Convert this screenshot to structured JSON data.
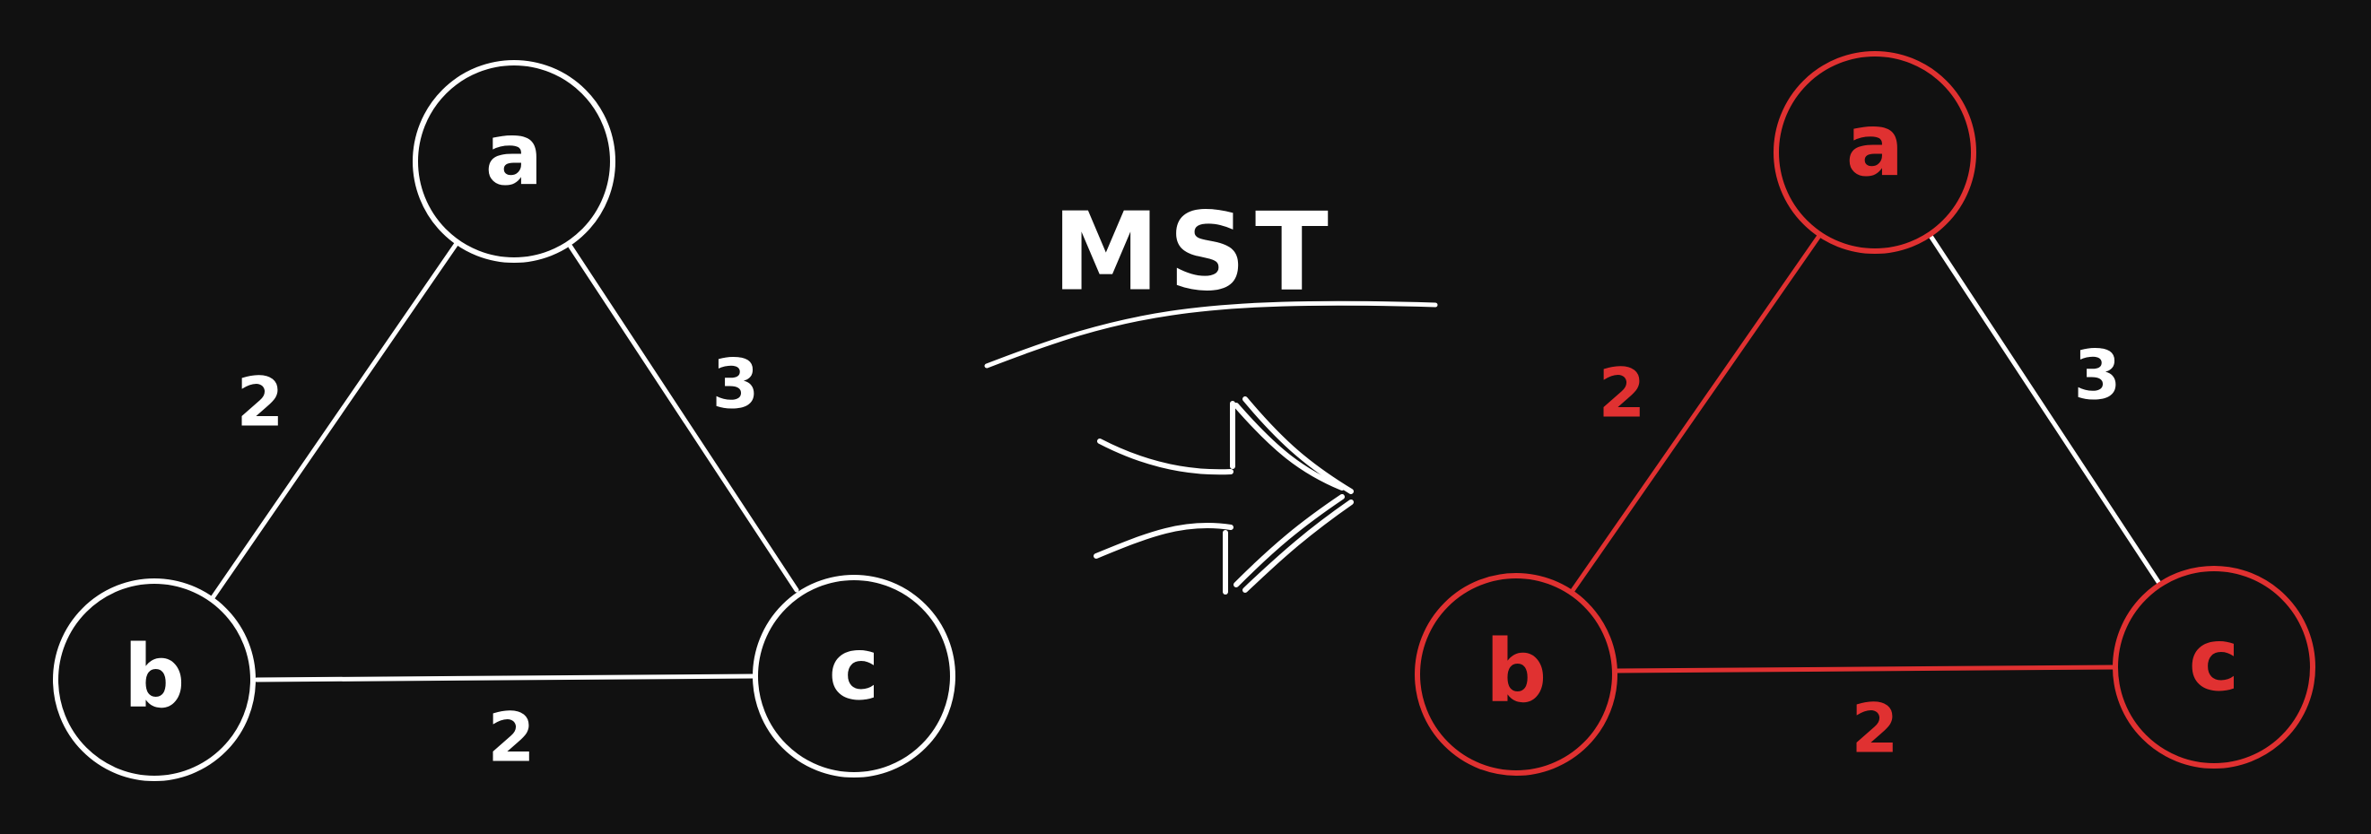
{
  "colors": {
    "background": "#111111",
    "default": "#ffffff",
    "mst": "#e03131"
  },
  "arrow": {
    "label": "MST",
    "icon": "double-arrow-right"
  },
  "graphs": [
    {
      "id": "input",
      "nodes": [
        {
          "id": "a",
          "label": "a",
          "color": "#ffffff"
        },
        {
          "id": "b",
          "label": "b",
          "color": "#ffffff"
        },
        {
          "id": "c",
          "label": "c",
          "color": "#ffffff"
        }
      ],
      "edges": [
        {
          "from": "a",
          "to": "b",
          "weight": "2",
          "in_mst": false
        },
        {
          "from": "a",
          "to": "c",
          "weight": "3",
          "in_mst": false
        },
        {
          "from": "b",
          "to": "c",
          "weight": "2",
          "in_mst": false
        }
      ]
    },
    {
      "id": "mst",
      "nodes": [
        {
          "id": "a",
          "label": "a",
          "color": "#e03131"
        },
        {
          "id": "b",
          "label": "b",
          "color": "#e03131"
        },
        {
          "id": "c",
          "label": "c",
          "color": "#e03131"
        }
      ],
      "edges": [
        {
          "from": "a",
          "to": "b",
          "weight": "2",
          "in_mst": true
        },
        {
          "from": "a",
          "to": "c",
          "weight": "3",
          "in_mst": false
        },
        {
          "from": "b",
          "to": "c",
          "weight": "2",
          "in_mst": true
        }
      ]
    }
  ]
}
